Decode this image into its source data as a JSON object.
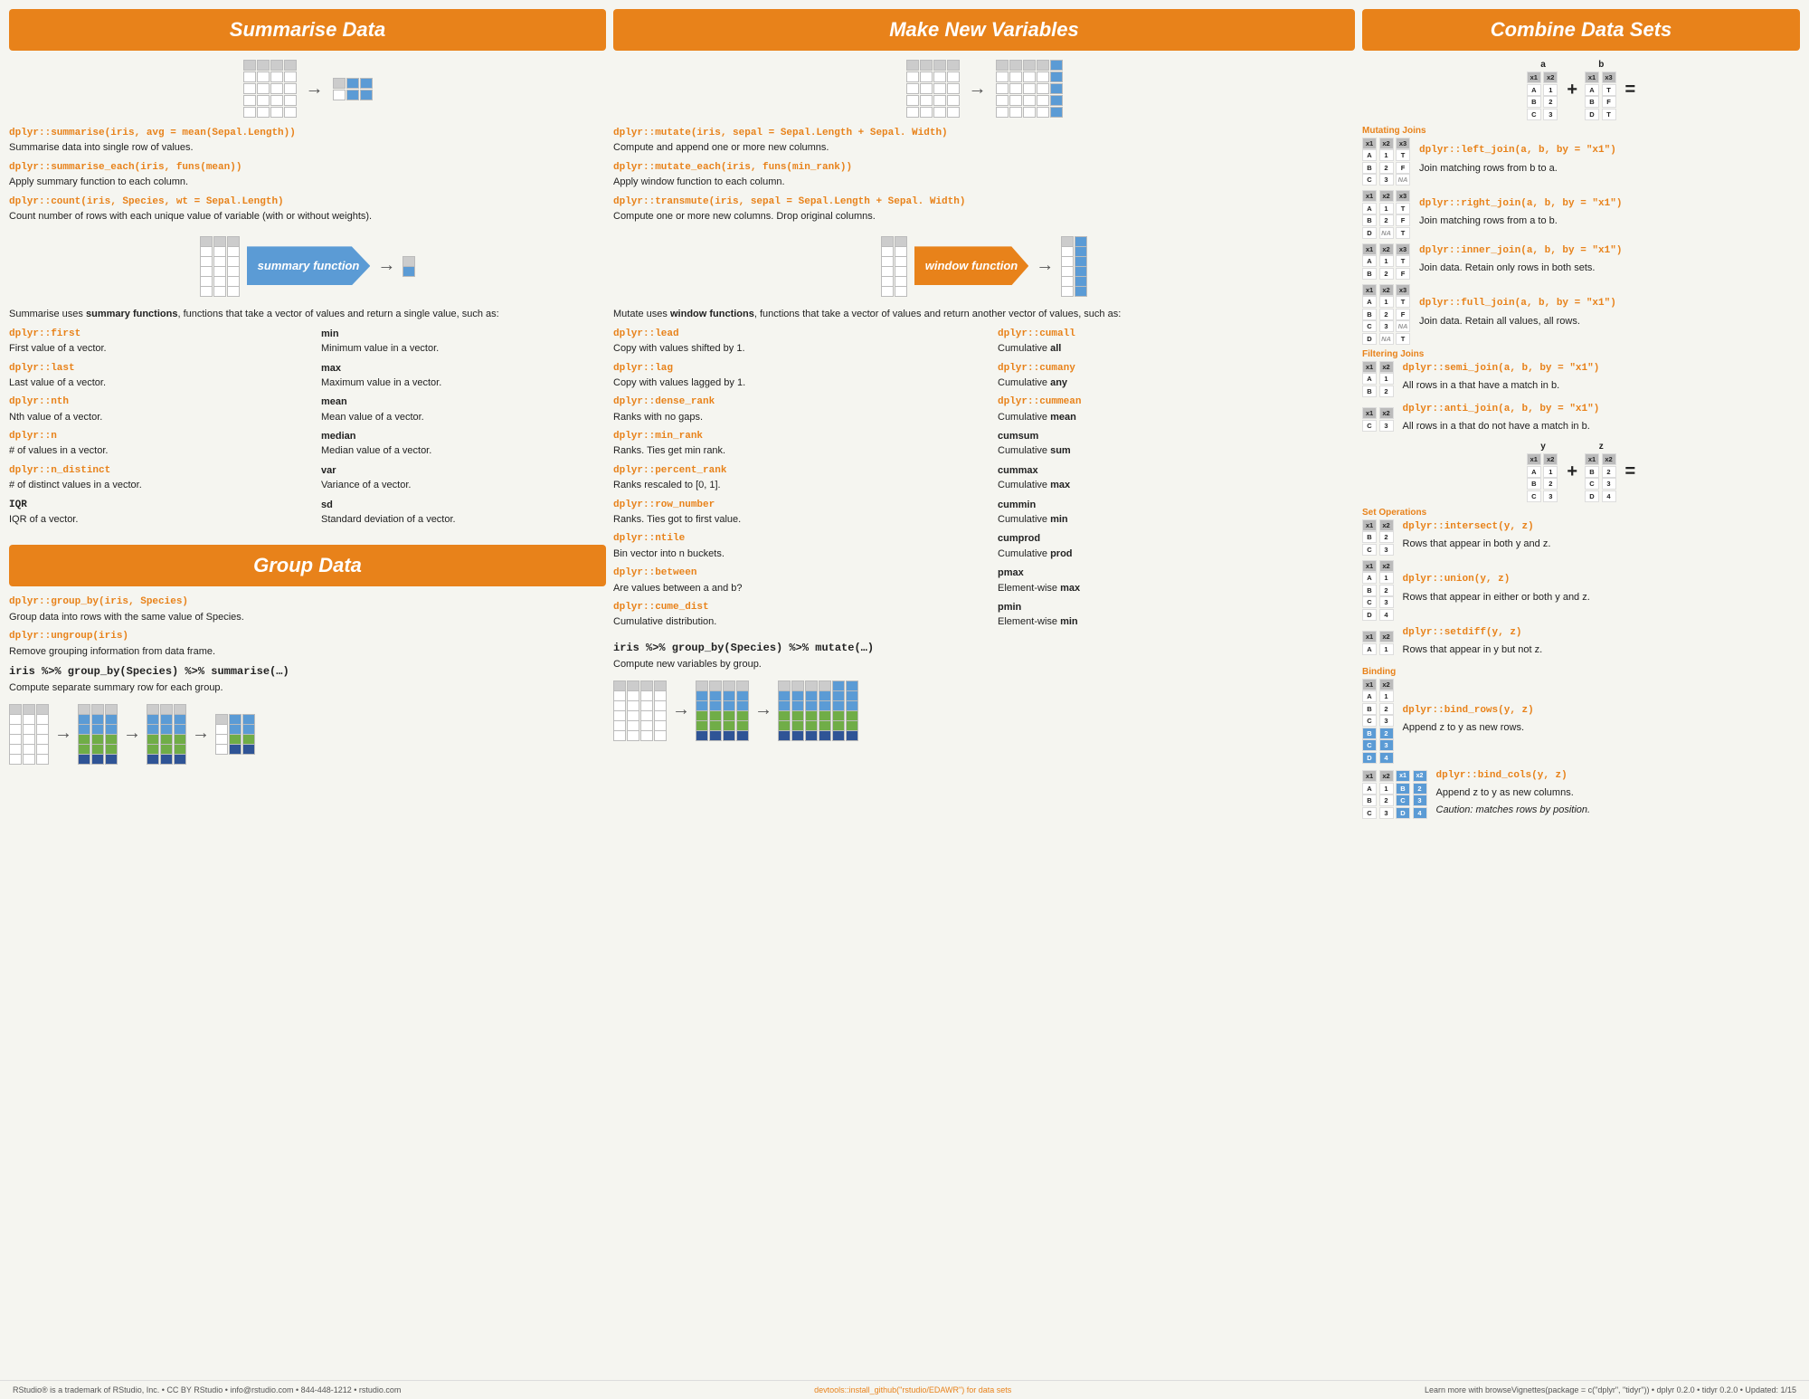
{
  "summarise": {
    "title": "Summarise Data",
    "functions": [
      {
        "code": "dplyr::summarise(iris, avg = mean(Sepal.Length))",
        "desc": "Summarise data into single row of values."
      },
      {
        "code": "dplyr::summarise_each(iris, funs(mean))",
        "desc": "Apply summary function to each column."
      },
      {
        "code": "dplyr::count(iris, Species, wt = Sepal.Length)",
        "desc": "Count number of rows with each unique value of variable (with or without weights)."
      }
    ],
    "summary_label": "summary function",
    "summary_desc1": "Summarise uses ",
    "summary_desc1b": "summary functions",
    "summary_desc1c": ", functions that take a vector of values and return a single value, such as:",
    "func_list": [
      {
        "code": "dplyr::first",
        "desc": "First value of a vector."
      },
      {
        "code": "dplyr::last",
        "desc": "Last value of a vector."
      },
      {
        "code": "dplyr::nth",
        "desc": "Nth value of a vector."
      },
      {
        "code": "dplyr::n",
        "desc": "# of values in a vector."
      },
      {
        "code": "dplyr::n_distinct",
        "desc": "# of distinct values in a vector."
      },
      {
        "code": "IQR",
        "desc": "IQR of a vector."
      }
    ],
    "func_list2": [
      {
        "code": "min",
        "desc": "Minimum value in a vector."
      },
      {
        "code": "max",
        "desc": "Maximum value in a vector."
      },
      {
        "code": "mean",
        "desc": "Mean value of a vector."
      },
      {
        "code": "median",
        "desc": "Median value of a vector."
      },
      {
        "code": "var",
        "desc": "Variance of a vector."
      },
      {
        "code": "sd",
        "desc": "Standard deviation of a vector."
      }
    ]
  },
  "group": {
    "title": "Group Data",
    "functions": [
      {
        "code": "dplyr::group_by(iris, Species)",
        "desc": "Group data into rows with the same value of Species."
      },
      {
        "code": "dplyr::ungroup(iris)",
        "desc": "Remove grouping information from data frame."
      }
    ],
    "pipeline": "iris %>% group_by(Species) %>% summarise(…)",
    "pipeline_desc": "Compute separate summary row for each group."
  },
  "makenew": {
    "title": "Make New Variables",
    "functions": [
      {
        "code": "dplyr::mutate(iris, sepal = Sepal.Length + Sepal. Width)",
        "desc": "Compute and append one or more new columns."
      },
      {
        "code": "dplyr::mutate_each(iris, funs(min_rank))",
        "desc": "Apply window function to each column."
      },
      {
        "code": "dplyr::transmute(iris, sepal = Sepal.Length + Sepal. Width)",
        "desc": "Compute one or more new columns. Drop original columns."
      }
    ],
    "window_label": "window function",
    "window_desc1": "Mutate uses ",
    "window_desc1b": "window functions",
    "window_desc1c": ", functions that take a vector of values and return another vector of values, such as:",
    "func_list_left": [
      {
        "code": "dplyr::lead",
        "desc": "Copy with values shifted by 1."
      },
      {
        "code": "dplyr::lag",
        "desc": "Copy with values lagged by 1."
      },
      {
        "code": "dplyr::dense_rank",
        "desc": "Ranks with no gaps."
      },
      {
        "code": "dplyr::min_rank",
        "desc": "Ranks. Ties get min rank."
      },
      {
        "code": "dplyr::percent_rank",
        "desc": "Ranks rescaled to [0, 1]."
      },
      {
        "code": "dplyr::row_number",
        "desc": "Ranks. Ties got to first value."
      },
      {
        "code": "dplyr::ntile",
        "desc": "Bin vector into n buckets."
      },
      {
        "code": "dplyr::between",
        "desc": "Are values between a and b?"
      },
      {
        "code": "dplyr::cume_dist",
        "desc": "Cumulative distribution."
      }
    ],
    "func_list_right": [
      {
        "code": "dplyr::cumall",
        "desc": "Cumulative all"
      },
      {
        "code": "dplyr::cumany",
        "desc": "Cumulative any"
      },
      {
        "code": "dplyr::cummean",
        "desc": "Cumulative mean"
      },
      {
        "code": "cumsum",
        "desc": "Cumulative sum"
      },
      {
        "code": "cummax",
        "desc": "Cumulative max"
      },
      {
        "code": "cummin",
        "desc": "Cumulative min"
      },
      {
        "code": "cumprod",
        "desc": "Cumulative prod"
      },
      {
        "code": "pmax",
        "desc": "Element-wise max"
      },
      {
        "code": "pmin",
        "desc": "Element-wise min"
      }
    ],
    "pipeline": "iris %>% group_by(Species) %>% mutate(…)",
    "pipeline_desc": "Compute new variables by group."
  },
  "combine": {
    "title": "Combine Data Sets",
    "mutating_joins_label": "Mutating Joins",
    "filtering_joins_label": "Filtering Joins",
    "set_ops_label": "Set Operations",
    "binding_label": "Binding",
    "joins": [
      {
        "code": "dplyr::left_join(a, b, by = \"x1\")",
        "desc": "Join matching rows from b to a."
      },
      {
        "code": "dplyr::right_join(a, b, by = \"x1\")",
        "desc": "Join matching rows from a to b."
      },
      {
        "code": "dplyr::inner_join(a, b, by = \"x1\")",
        "desc": "Join data. Retain only rows in both sets."
      },
      {
        "code": "dplyr::full_join(a, b, by = \"x1\")",
        "desc": "Join data. Retain all values, all rows."
      }
    ],
    "filter_joins": [
      {
        "code": "dplyr::semi_join(a, b, by = \"x1\")",
        "desc": "All rows in a that have a match in b."
      },
      {
        "code": "dplyr::anti_join(a, b, by = \"x1\")",
        "desc": "All rows in a that do not have a match in b."
      }
    ],
    "set_ops": [
      {
        "code": "dplyr::intersect(y, z)",
        "desc": "Rows that appear in both y and z."
      },
      {
        "code": "dplyr::union(y, z)",
        "desc": "Rows that appear in either or both y and z."
      },
      {
        "code": "dplyr::setdiff(y, z)",
        "desc": "Rows that appear in y but not z."
      }
    ],
    "binding": [
      {
        "code": "dplyr::bind_rows(y, z)",
        "desc": "Append z to y as new rows."
      },
      {
        "code": "dplyr::bind_cols(y, z)",
        "desc": "Append z to y as new columns.",
        "caution": "Caution: matches rows by position."
      }
    ]
  },
  "footer": {
    "left": "RStudio® is a trademark of RStudio, Inc. • CC BY RStudio • info@rstudio.com • 844-448-1212 • rstudio.com",
    "mid": "devtools::install_github(\"rstudio/EDAWR\") for data sets",
    "right": "Learn more with browseVignettes(package = c(\"dplyr\", \"tidyr\")) • dplyr 0.2.0 • tidyr 0.2.0 • Updated: 1/15"
  }
}
